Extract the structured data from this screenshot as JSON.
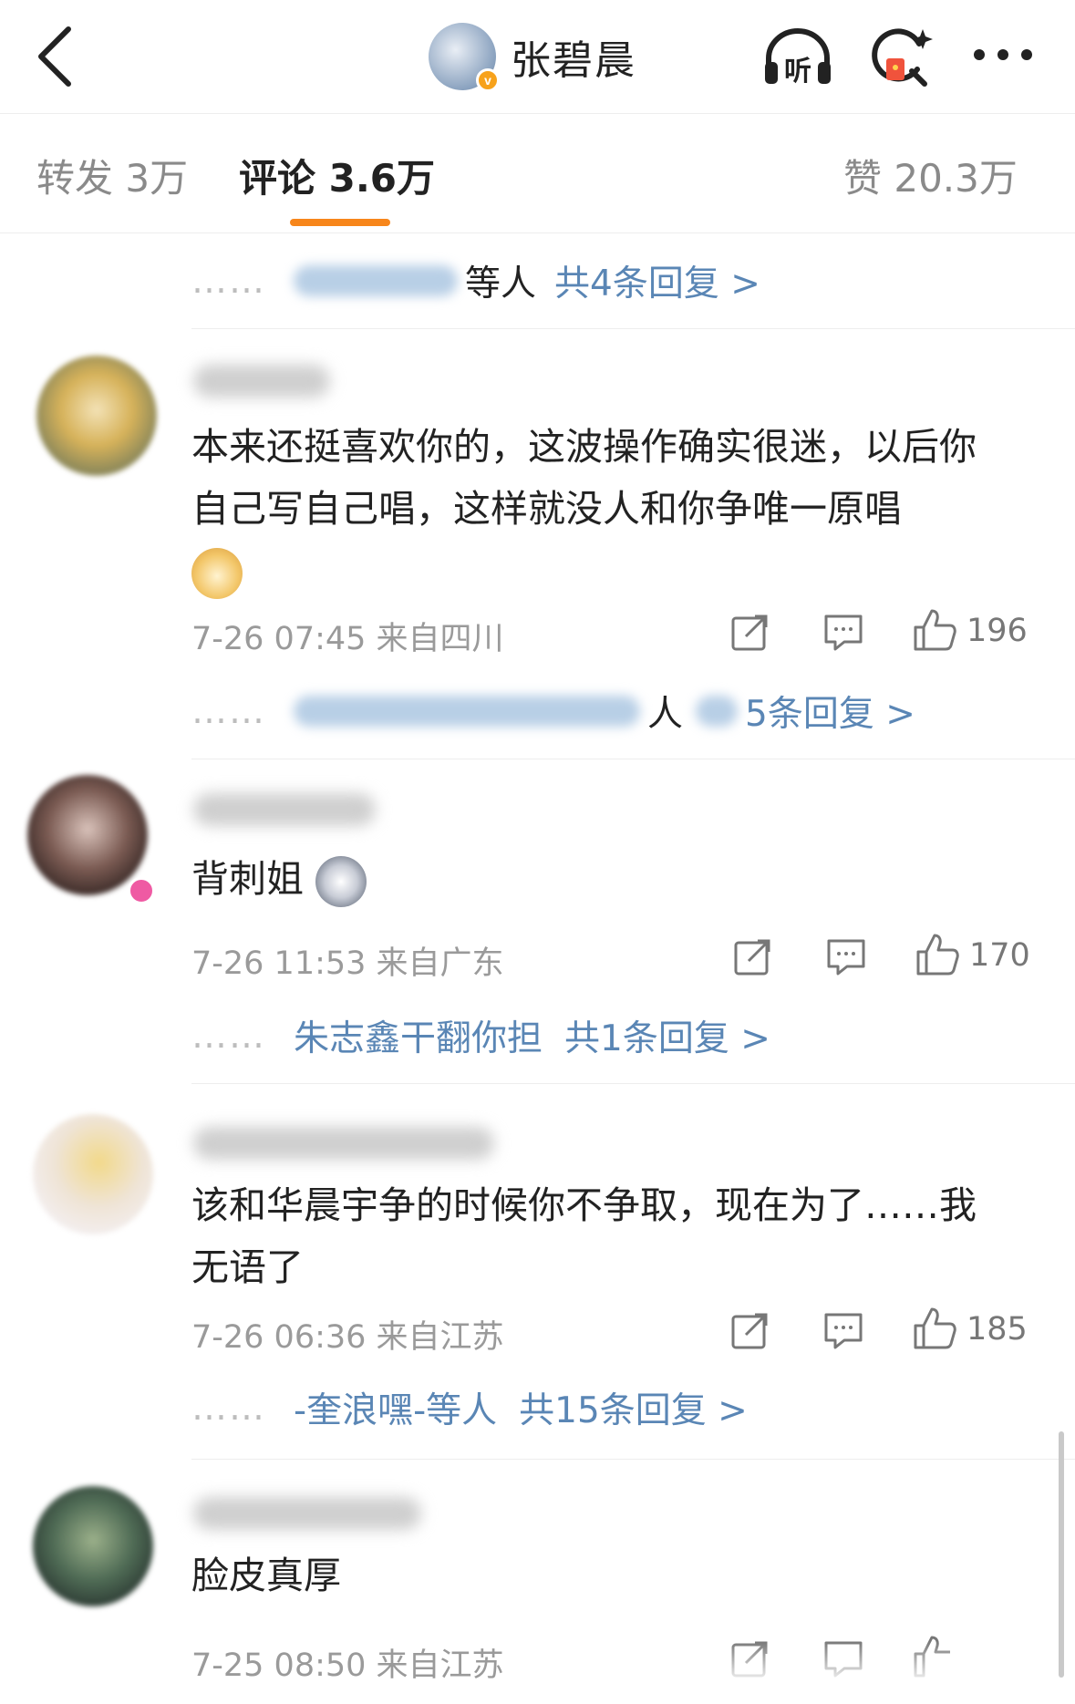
{
  "header": {
    "title": "张碧晨",
    "verified_badge": "v",
    "icons": [
      "back-arrow-icon",
      "listen-icon",
      "search-red-packet-icon",
      "more-icon"
    ],
    "listen_label": "听"
  },
  "tabs": [
    {
      "label": "转发 3万"
    },
    {
      "label": "评论 3.6万"
    },
    {
      "label": "赞 20.3万"
    }
  ],
  "accent_color": "#f7861b",
  "link_color": "#5a86b5",
  "top_reply": {
    "dots": "……",
    "suffix": "等人",
    "count_link": "共4条回复 >"
  },
  "comments": [
    {
      "text": "本来还挺喜欢你的，这波操作确实很迷，以后你自己写自己唱，这样就没人和你争唯一原唱",
      "time": "7-26 07:45 来自四川",
      "likes": "196",
      "reply_dots": "……",
      "reply_suffix": "人",
      "reply_count": "5条回复 >"
    },
    {
      "text": "背刺姐",
      "time": "7-26 11:53 来自广东",
      "likes": "170",
      "reply_dots": "……",
      "reply_user": "朱志鑫干翻你担",
      "reply_count": "共1条回复 >"
    },
    {
      "text": "该和华晨宇争的时候你不争取，现在为了……我无语了",
      "time": "7-26 06:36 来自江苏",
      "likes": "185",
      "reply_dots": "……",
      "reply_user": "-奎浪嘿-等人",
      "reply_count": "共15条回复 >"
    },
    {
      "text": "脸皮真厚",
      "time": "7-25 08:50 来自江苏"
    }
  ]
}
